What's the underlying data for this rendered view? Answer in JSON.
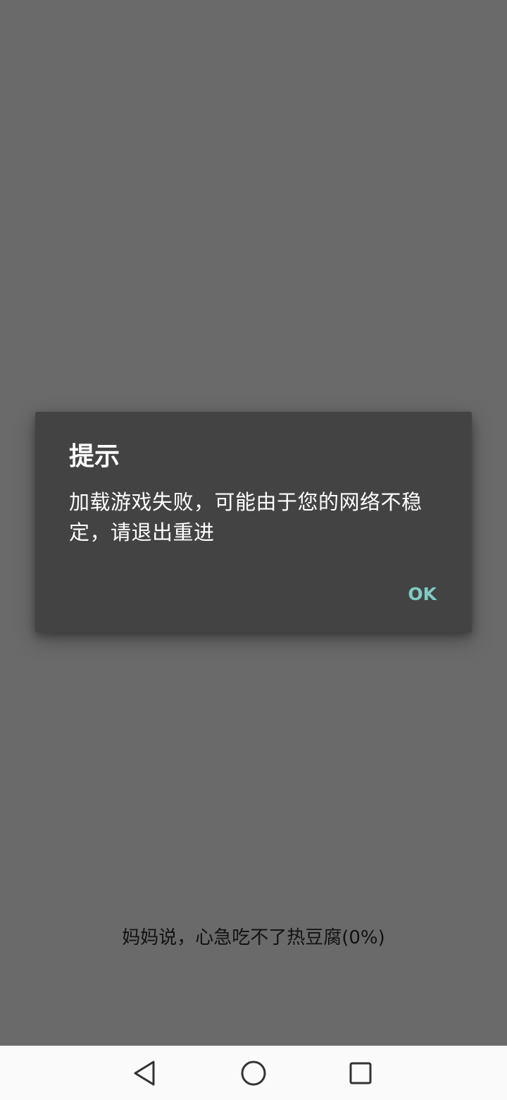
{
  "background": {
    "loading_message": "妈妈说，心急吃不了热豆腐(0%)"
  },
  "dialog": {
    "title": "提示",
    "message": "加载游戏失败，可能由于您的网络不稳定，请退出重进",
    "ok_label": "OK"
  },
  "navbar": {
    "back_icon": "back-triangle-icon",
    "home_icon": "home-circle-icon",
    "recent_icon": "recent-apps-square-icon"
  },
  "colors": {
    "screen_background": "#6a6a6a",
    "dialog_background": "#434343",
    "accent": "#80cbc4",
    "navbar_background": "#fafafa"
  }
}
